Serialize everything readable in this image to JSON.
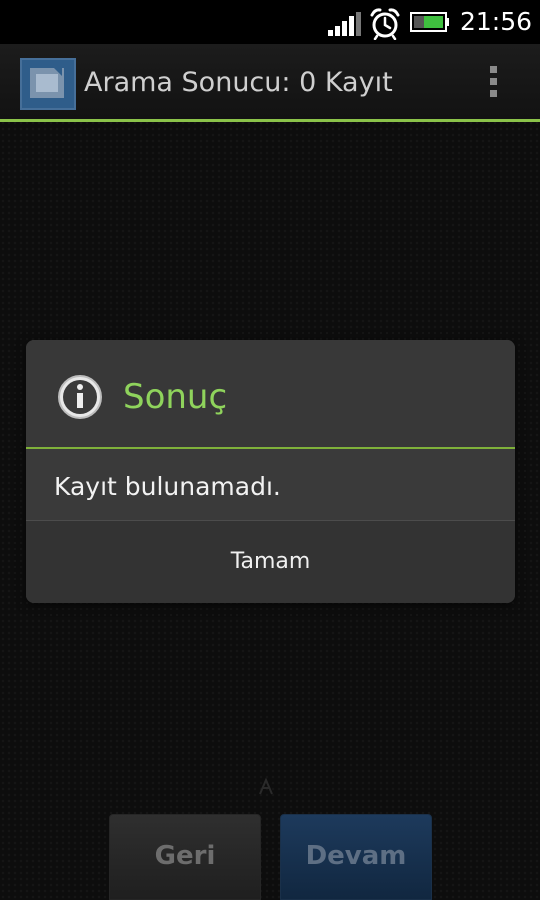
{
  "status_bar": {
    "time": "21:56",
    "icons": [
      "signal-icon",
      "alarm-clock-icon",
      "battery-icon"
    ],
    "battery_color": "#3fbf3f"
  },
  "action_bar": {
    "app_icon": "app-logo-icon",
    "title": "Arama Sonucu: 0 Kayıt",
    "menu_icon": "overflow-menu-icon",
    "accent_color": "#8bc34a"
  },
  "dialog": {
    "icon": "info-icon",
    "title": "Sonuç",
    "message": "Kayıt bulunamadı.",
    "ok_label": "Tamam",
    "title_color": "#8fd35c"
  },
  "bottom": {
    "back_label": "Geri",
    "next_label": "Devam"
  }
}
